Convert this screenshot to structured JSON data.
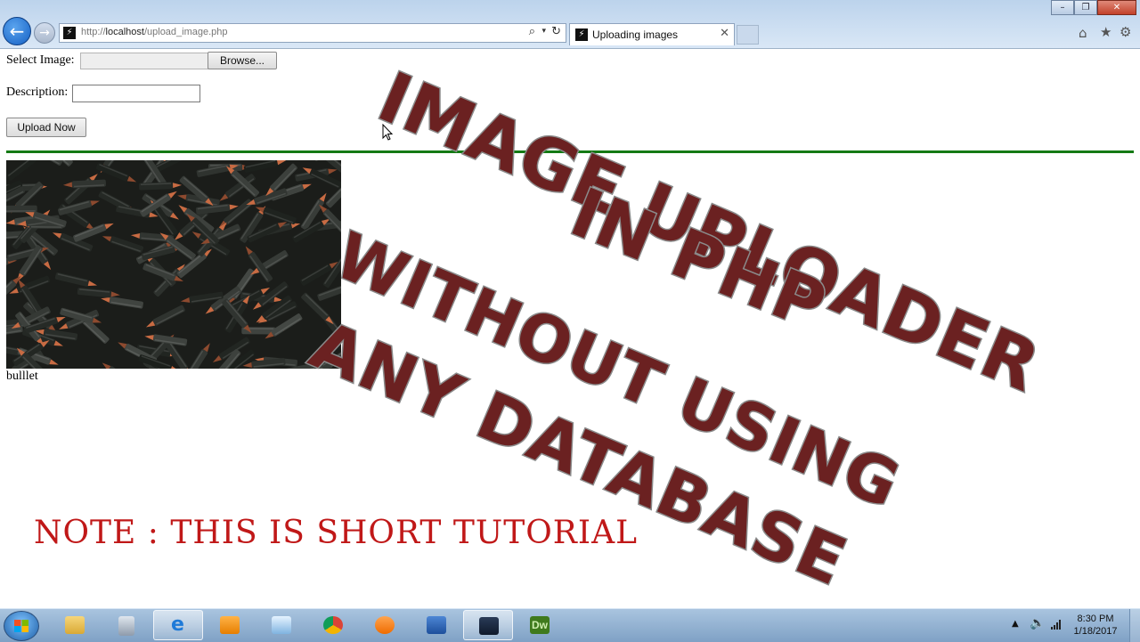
{
  "browser": {
    "url_prefix": "http://",
    "url_host": "localhost",
    "url_path": "/upload_image.php",
    "tab_title": "Uploading images"
  },
  "form": {
    "select_image_label": "Select Image:",
    "browse_label": "Browse...",
    "description_label": "Description:",
    "description_value": "",
    "upload_label": "Upload Now"
  },
  "gallery": {
    "image_icon": "bullets-photo",
    "caption": "bulllet"
  },
  "overlay": {
    "lines": [
      "IMAGE UPLOADER",
      "IN PHP",
      "WITHOUT USING",
      "ANY DATABASE"
    ],
    "color": "#6b2121",
    "outline_color": "#8a8a8a"
  },
  "note": {
    "text": "NOTE : THIS IS SHORT TUTORIAL",
    "color": "#c01818"
  },
  "divider_color": "#147a14",
  "taskbar": {
    "apps": [
      "file-explorer",
      "calculator",
      "internet-explorer",
      "media-player",
      "sticky-notes",
      "chrome",
      "uc-browser",
      "word",
      "screen-recorder",
      "dreamweaver"
    ],
    "active_app": "internet-explorer",
    "time": "8:30 PM",
    "date": "1/18/2017"
  }
}
